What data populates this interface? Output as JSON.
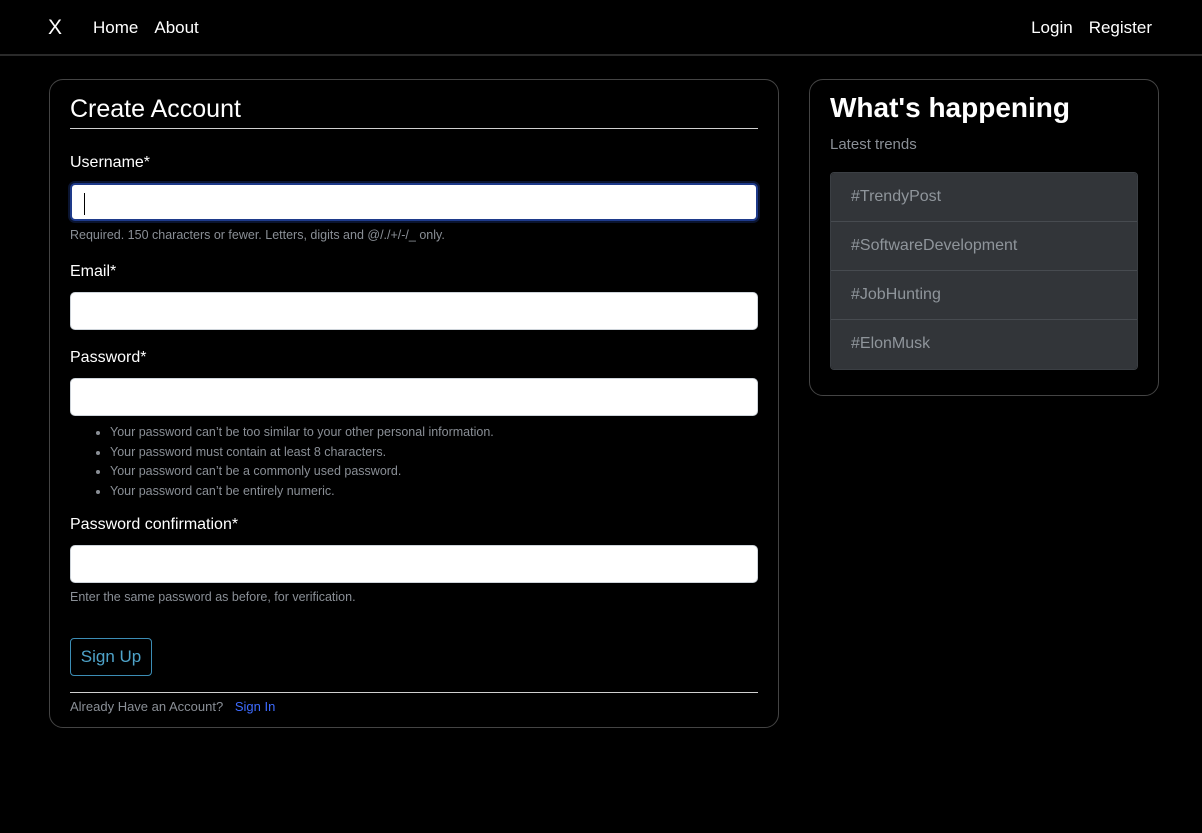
{
  "navbar": {
    "brand": "X",
    "left_links": [
      "Home",
      "About"
    ],
    "right_links": [
      "Login",
      "Register"
    ]
  },
  "form": {
    "title": "Create Account",
    "username": {
      "label": "Username*",
      "value": "",
      "help": "Required. 150 characters or fewer. Letters, digits and @/./+/-/_ only."
    },
    "email": {
      "label": "Email*",
      "value": ""
    },
    "password": {
      "label": "Password*",
      "value": "",
      "rules": [
        "Your password can’t be too similar to your other personal information.",
        "Your password must contain at least 8 characters.",
        "Your password can’t be a commonly used password.",
        "Your password can’t be entirely numeric."
      ]
    },
    "password_confirmation": {
      "label": "Password confirmation*",
      "value": "",
      "help": "Enter the same password as before, for verification."
    },
    "submit_label": "Sign Up",
    "footer_text": "Already Have an Account?",
    "footer_link": "Sign In"
  },
  "sidebar": {
    "title": "What's happening",
    "subtitle": "Latest trends",
    "trends": [
      "#TrendyPost",
      "#SoftwareDevelopment",
      "#JobHunting",
      "#ElonMusk"
    ]
  },
  "colors": {
    "background": "#000000",
    "link_accent": "#3d6bff",
    "button_accent": "#4ea3c9",
    "muted_text": "#8a8f96",
    "trend_item_bg": "#323539"
  }
}
